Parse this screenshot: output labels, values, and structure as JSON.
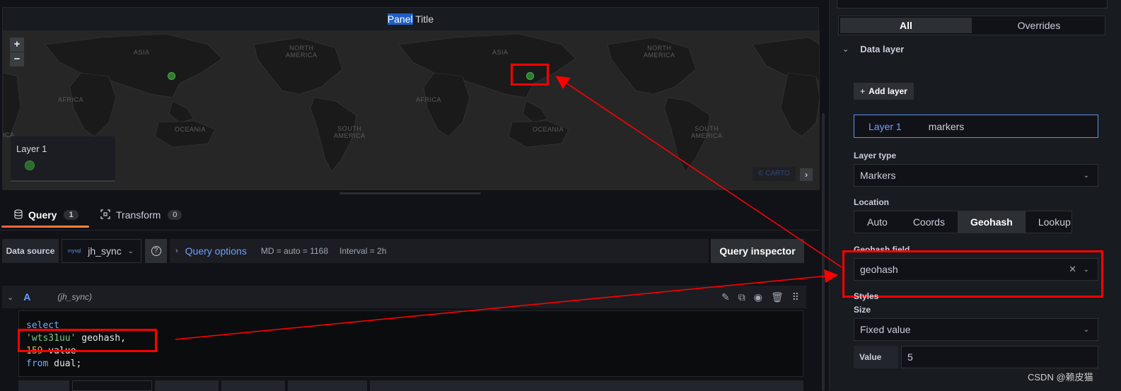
{
  "panel": {
    "title_selected": "Panel",
    "title_rest": " Title",
    "zoom_in": "+",
    "zoom_out": "−",
    "legend_label": "Layer 1",
    "attribution": "© CARTO",
    "map_labels": {
      "asia1": "ASIA",
      "north_america1": "NORTH\nAMERICA",
      "africa1": "AFRICA",
      "oceania1": "OCEANIA",
      "south_america1": "SOUTH\nAMERICA",
      "asia2": "ASIA",
      "north_america2": "NORTH\nAMERICA",
      "africa2": "AFRICA",
      "oceania2": "OCEANIA",
      "south_america2": "SOUTH\nAMERICA",
      "africa0": "ICA"
    }
  },
  "tabs": [
    {
      "label": "Query",
      "count": "1"
    },
    {
      "label": "Transform",
      "count": "0"
    }
  ],
  "query_bar": {
    "datasource_label": "Data source",
    "datasource_logo": "mysql",
    "datasource_name": "jh_sync",
    "query_options": "Query options",
    "md": "MD = auto = 1168",
    "interval": "Interval = 2h",
    "query_inspector": "Query inspector"
  },
  "query": {
    "letter": "A",
    "datasource": "(jh_sync)",
    "code": {
      "l1": "select",
      "l2_str": "'wts31uu'",
      "l2_rest": " geohash,",
      "l3_num": "159",
      "l3_rest": " value",
      "l4_kw": "from",
      "l4_rest": " dual;"
    }
  },
  "options": {
    "segment_all": "All",
    "segment_overrides": "Overrides",
    "section_title": "Data layer",
    "add_layer": "Add layer",
    "layer_name": "Layer 1",
    "layer_kind": "markers",
    "layer_type_label": "Layer type",
    "layer_type_value": "Markers",
    "location_label": "Location",
    "location_options": [
      "Auto",
      "Coords",
      "Geohash",
      "Lookup"
    ],
    "location_selected": "Geohash",
    "geohash_field_label": "Geohash field",
    "geohash_field_value": "geohash",
    "styles_label": "Styles",
    "size_label": "Size",
    "size_value": "Fixed value",
    "value_label": "Value",
    "value_value": "5"
  },
  "watermark": "CSDN @赖皮猫",
  "colors": {
    "accent_blue": "#6e9fff",
    "annotation_red": "#ff0000",
    "marker_green": "#4caf50",
    "tab_gradient": "#f55f3e"
  }
}
